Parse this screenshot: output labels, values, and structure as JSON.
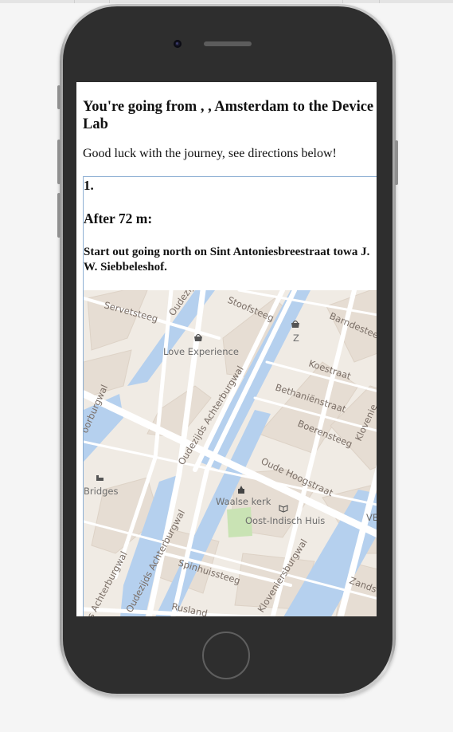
{
  "page": {
    "heading": "You're going from , , Amsterdam to the Device Lab",
    "subheading": "Good luck with the journey, see directions below!"
  },
  "step": {
    "number": "1.",
    "distance": "After 72 m:",
    "instruction": "Start out going north on Sint Antoniesbreestraat towa J. W. Siebbeleshof."
  },
  "map": {
    "streets": {
      "servetsteeg": "Servetsteeg",
      "oudezijds_top": "Oudezij",
      "stoofsteeg": "Stoofsteeg",
      "barndesteeg": "Barndestee",
      "koestraat": "Koestraat",
      "bethanienstraat": "Bethaniënstraat",
      "boerensteeg": "Boerensteeg",
      "achterburgwal": "Oudezijds Achterburgwal",
      "achterburgwal_left": "oorburgwal",
      "oude_hoogstraat": "Oude Hoogstraat",
      "kloveniersburgwal_right": "Klovenie",
      "spinhuissteeg": "Spinhuissteeg",
      "achterburgwal_bottom": "Oudezijds Achterburgwal",
      "zijds_achterburgwal": "zijds Achterburgwal",
      "kloveniersburgwal": "Kloveniersburgwal",
      "rusland": "Rusland",
      "zand": "Zands"
    },
    "pois": {
      "love_experience": "Love Experience",
      "bridges": "Bridges",
      "waalse_kerk": "Waalse kerk",
      "oost_indisch_huis": "Oost-Indisch Huis",
      "z_label": "Z",
      "ve_label": "VE"
    },
    "colors": {
      "land": "#f0ebe4",
      "water": "#b5d0ee",
      "building": "#e4dcd3",
      "park": "#c9e3b4",
      "road": "#ffffff"
    }
  }
}
